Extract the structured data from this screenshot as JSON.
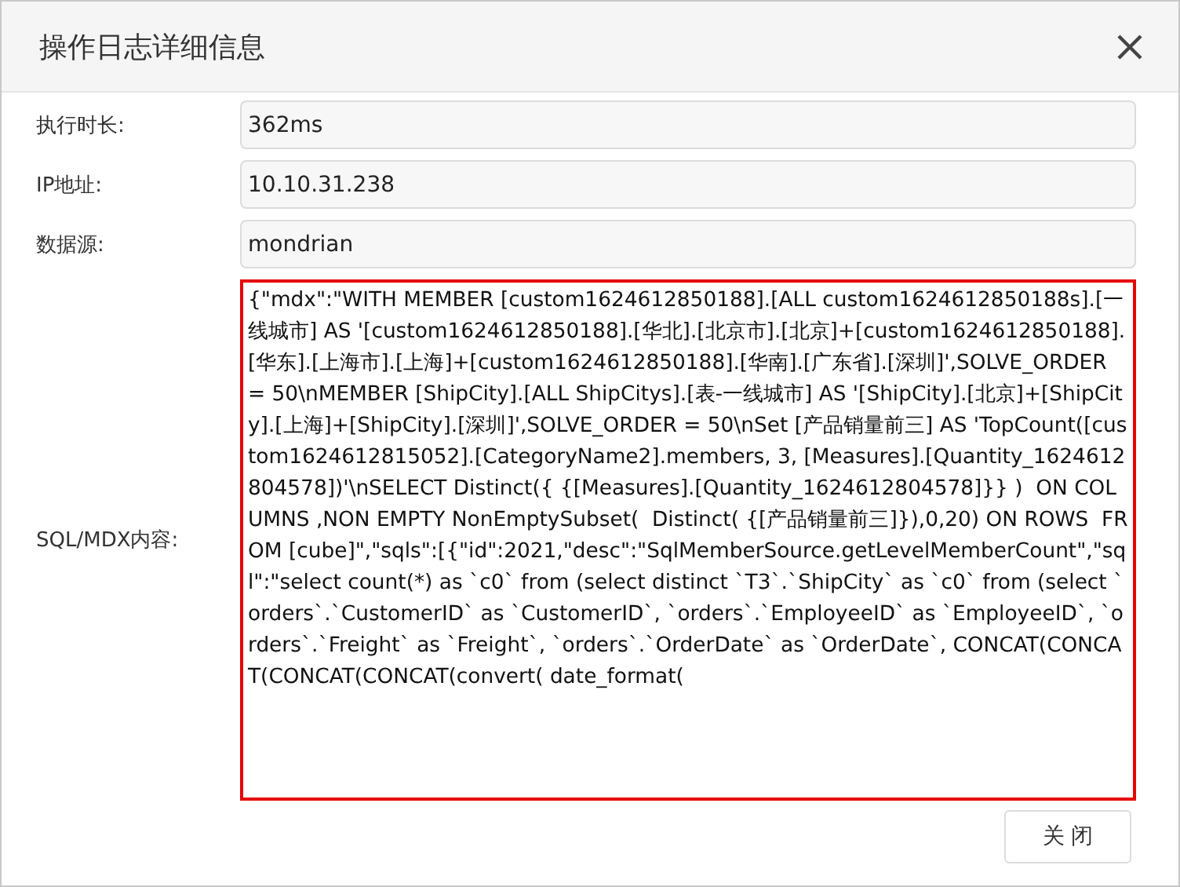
{
  "dialog": {
    "title": "操作日志详细信息"
  },
  "fields": [
    {
      "label": "执行时长:",
      "value": "362ms",
      "kind": "input"
    },
    {
      "label": "IP地址:",
      "value": "10.10.31.238",
      "kind": "input"
    },
    {
      "label": "数据源:",
      "value": "mondrian",
      "kind": "input"
    },
    {
      "label": "SQL/MDX内容:",
      "value": "{\"mdx\":\"WITH MEMBER [custom1624612850188].[ALL custom1624612850188s].[一线城市] AS '[custom1624612850188].[华北].[北京市].[北京]+[custom1624612850188].[华东].[上海市].[上海]+[custom1624612850188].[华南].[广东省].[深圳]',SOLVE_ORDER = 50\\nMEMBER [ShipCity].[ALL ShipCitys].[表-一线城市] AS '[ShipCity].[北京]+[ShipCity].[上海]+[ShipCity].[深圳]',SOLVE_ORDER = 50\\nSet [产品销量前三] AS 'TopCount([custom1624612815052].[CategoryName2].members, 3, [Measures].[Quantity_1624612804578])'\\nSELECT Distinct({ {[Measures].[Quantity_1624612804578]}} )  ON COLUMNS ,NON EMPTY NonEmptySubset(  Distinct( {[产品销量前三]}),0,20) ON ROWS  FROM [cube]\",\"sqls\":[{\"id\":2021,\"desc\":\"SqlMemberSource.getLevelMemberCount\",\"sql\":\"select count(*) as `c0` from (select distinct `T3`.`ShipCity` as `c0` from (select `orders`.`CustomerID` as `CustomerID`, `orders`.`EmployeeID` as `EmployeeID`, `orders`.`Freight` as `Freight`, `orders`.`OrderDate` as `OrderDate`, CONCAT(CONCAT(CONCAT(CONCAT(convert( date_format(",
      "kind": "textarea"
    }
  ],
  "buttons": [
    {
      "label": "关 闭"
    }
  ]
}
